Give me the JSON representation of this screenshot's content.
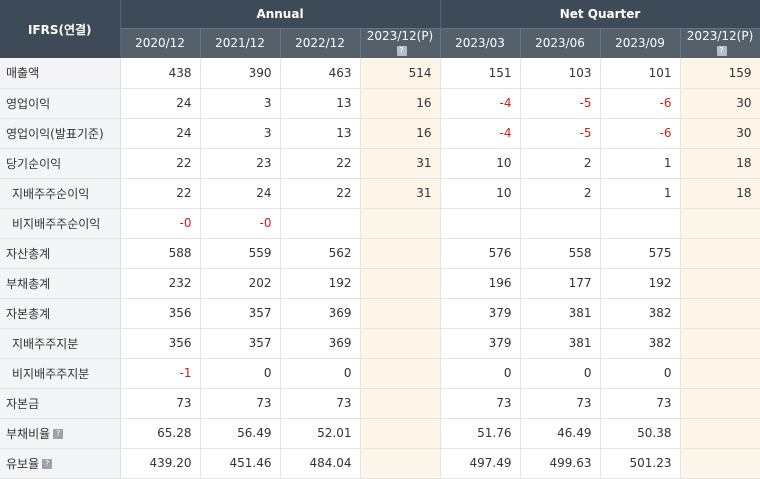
{
  "header": {
    "corner": "IFRS(연결)",
    "group_annual": "Annual",
    "group_quarter": "Net Quarter",
    "periods": [
      "2020/12",
      "2021/12",
      "2022/12",
      "2023/12(P)",
      "2023/03",
      "2023/06",
      "2023/09",
      "2023/12(P)"
    ],
    "help_glyph": "?"
  },
  "rows": [
    {
      "label": "매출액",
      "indent": false,
      "help": false,
      "values": [
        "438",
        "390",
        "463",
        "514",
        "151",
        "103",
        "101",
        "159"
      ]
    },
    {
      "label": "영업이익",
      "indent": false,
      "help": false,
      "values": [
        "24",
        "3",
        "13",
        "16",
        "-4",
        "-5",
        "-6",
        "30"
      ]
    },
    {
      "label": "영업이익(발표기준)",
      "indent": false,
      "help": false,
      "values": [
        "24",
        "3",
        "13",
        "16",
        "-4",
        "-5",
        "-6",
        "30"
      ]
    },
    {
      "label": "당기순이익",
      "indent": false,
      "help": false,
      "values": [
        "22",
        "23",
        "22",
        "31",
        "10",
        "2",
        "1",
        "18"
      ]
    },
    {
      "label": "지배주주순이익",
      "indent": true,
      "help": false,
      "values": [
        "22",
        "24",
        "22",
        "31",
        "10",
        "2",
        "1",
        "18"
      ]
    },
    {
      "label": "비지배주주순이익",
      "indent": true,
      "help": false,
      "values": [
        "-0",
        "-0",
        "",
        "",
        "",
        "",
        "",
        ""
      ]
    },
    {
      "label": "자산총계",
      "indent": false,
      "help": false,
      "values": [
        "588",
        "559",
        "562",
        "",
        "576",
        "558",
        "575",
        ""
      ]
    },
    {
      "label": "부채총계",
      "indent": false,
      "help": false,
      "values": [
        "232",
        "202",
        "192",
        "",
        "196",
        "177",
        "192",
        ""
      ]
    },
    {
      "label": "자본총계",
      "indent": false,
      "help": false,
      "values": [
        "356",
        "357",
        "369",
        "",
        "379",
        "381",
        "382",
        ""
      ]
    },
    {
      "label": "지배주주지분",
      "indent": true,
      "help": false,
      "values": [
        "356",
        "357",
        "369",
        "",
        "379",
        "381",
        "382",
        ""
      ]
    },
    {
      "label": "비지배주주지분",
      "indent": true,
      "help": false,
      "values": [
        "-1",
        "0",
        "0",
        "",
        "0",
        "0",
        "0",
        ""
      ]
    },
    {
      "label": "자본금",
      "indent": false,
      "help": false,
      "values": [
        "73",
        "73",
        "73",
        "",
        "73",
        "73",
        "73",
        ""
      ]
    },
    {
      "label": "부채비율",
      "indent": false,
      "help": true,
      "values": [
        "65.28",
        "56.49",
        "52.01",
        "",
        "51.76",
        "46.49",
        "50.38",
        ""
      ]
    },
    {
      "label": "유보율",
      "indent": false,
      "help": true,
      "values": [
        "439.20",
        "451.46",
        "484.04",
        "",
        "497.49",
        "499.63",
        "501.23",
        ""
      ]
    }
  ],
  "colors": {
    "header_dark": "#3d4a57",
    "header_mid": "#54616d",
    "estimate_bg": "#fdf6e8",
    "negative": "#d21d1d",
    "label_bg": "#f3f5f7"
  }
}
